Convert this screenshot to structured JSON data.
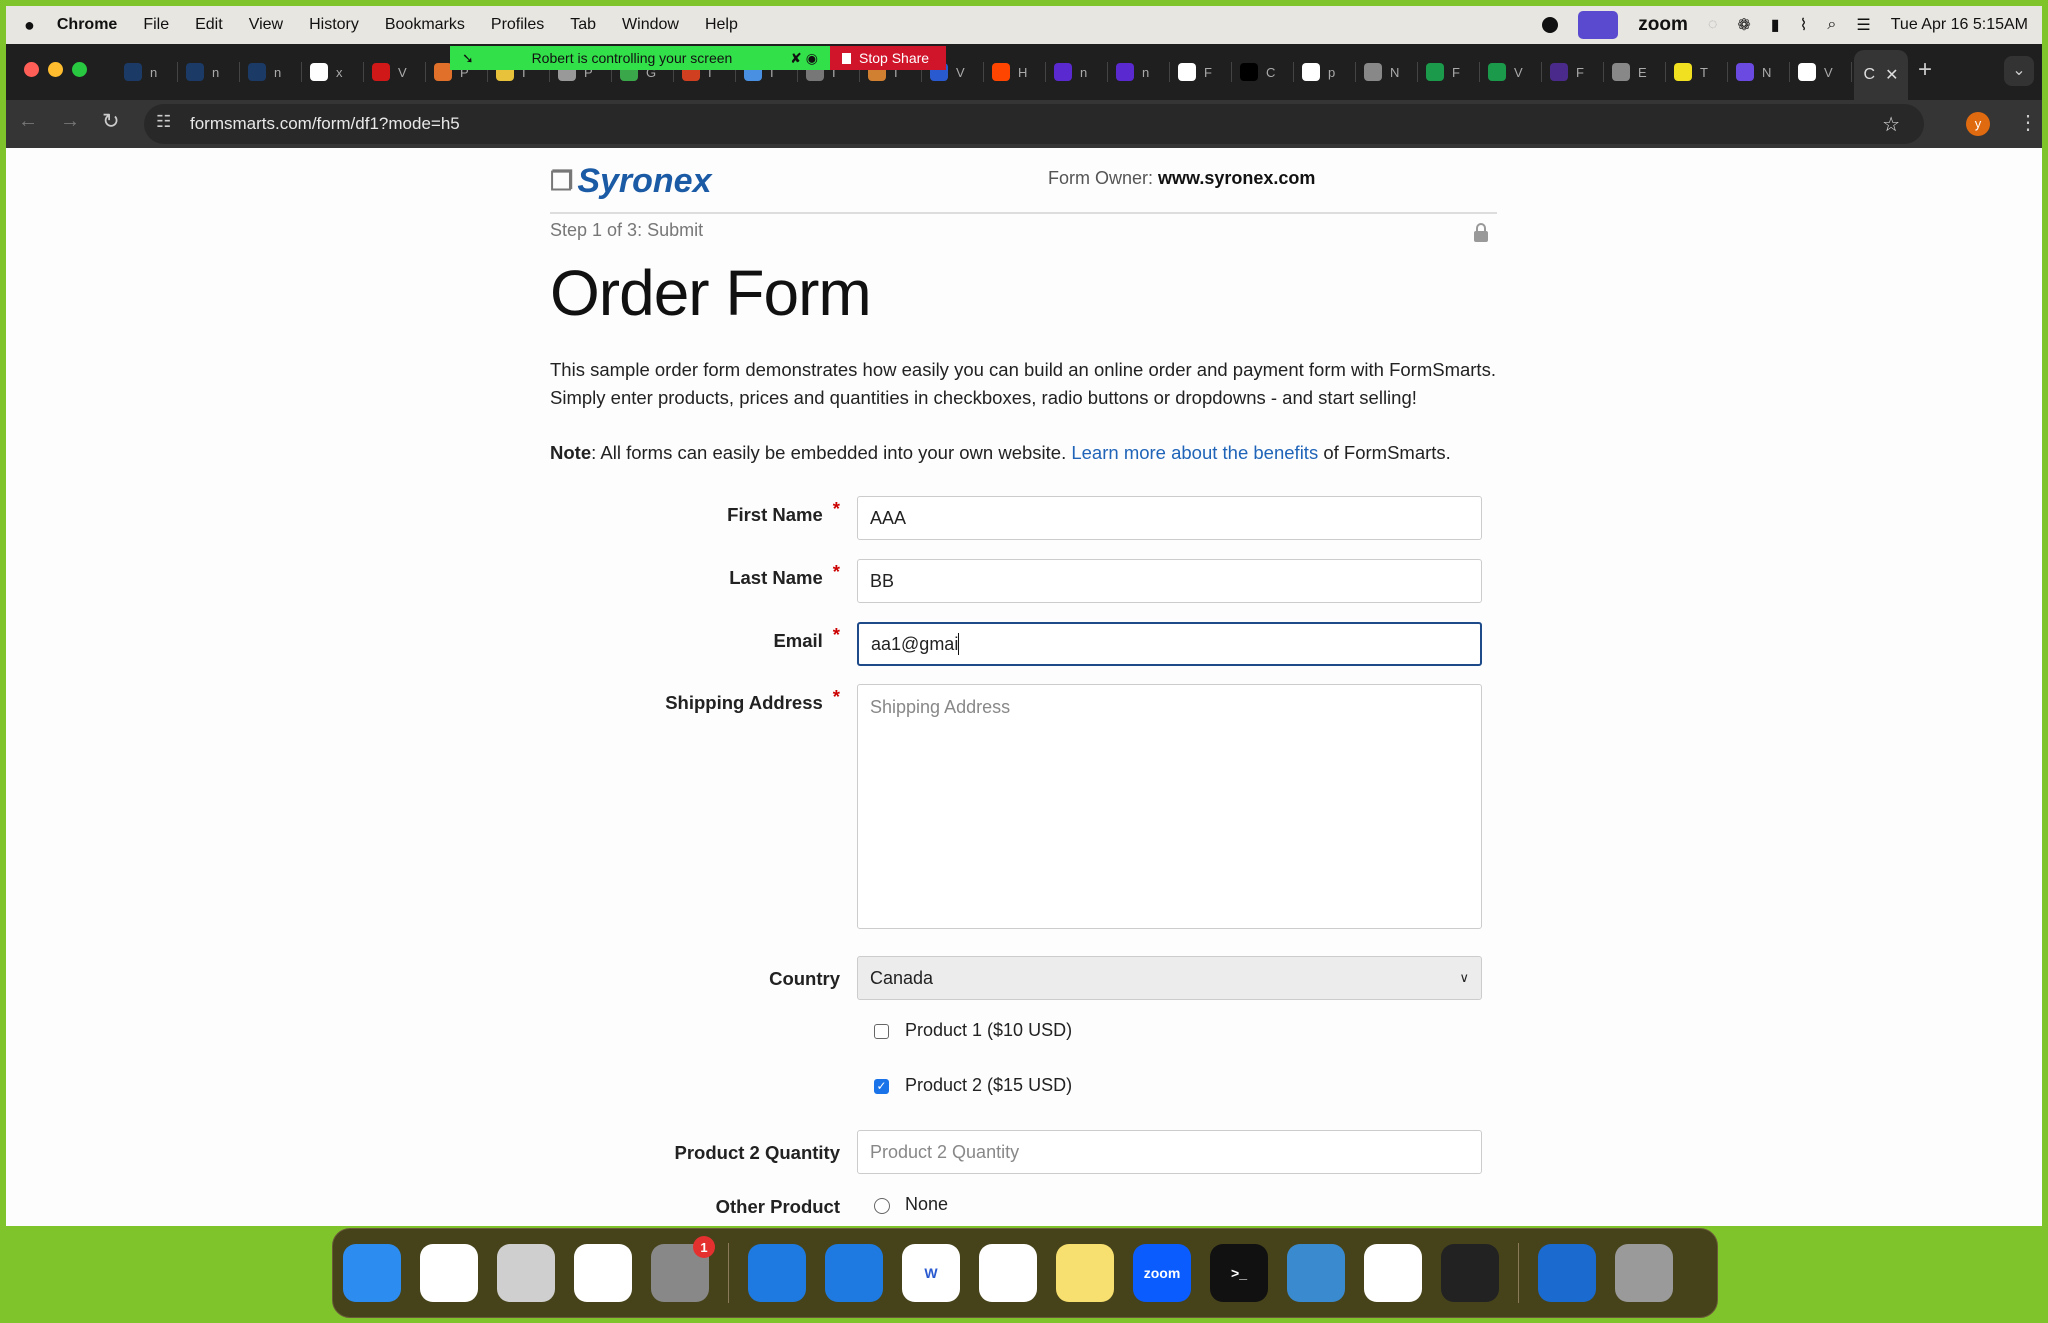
{
  "menubar": {
    "app": "Chrome",
    "items": [
      "File",
      "Edit",
      "View",
      "History",
      "Bookmarks",
      "Profiles",
      "Tab",
      "Window",
      "Help"
    ],
    "status": {
      "zoom_label": "zoom",
      "datetime": "Tue Apr 16  5:15AM"
    }
  },
  "zoom_share": {
    "message": "Robert is controlling your screen",
    "stop_label": "Stop Share",
    "color": "#32e14a",
    "stop_color": "#d0152b"
  },
  "tabs": [
    {
      "letter": "n",
      "color": "#1b3a66"
    },
    {
      "letter": "n",
      "color": "#1b3a66"
    },
    {
      "letter": "n",
      "color": "#1b3a66"
    },
    {
      "letter": "x",
      "color": "#ffffff"
    },
    {
      "letter": "V",
      "color": "#d01818"
    },
    {
      "letter": "P",
      "color": "#e0702a"
    },
    {
      "letter": "I",
      "color": "#e8c23a"
    },
    {
      "letter": "P",
      "color": "#999999"
    },
    {
      "letter": "G",
      "color": "#3aa84a"
    },
    {
      "letter": "I",
      "color": "#d04020"
    },
    {
      "letter": "I",
      "color": "#4a90e2"
    },
    {
      "letter": "I",
      "color": "#777777"
    },
    {
      "letter": "I",
      "color": "#d08030"
    },
    {
      "letter": "V",
      "color": "#2a5ad0"
    },
    {
      "letter": "H",
      "color": "#ff4500"
    },
    {
      "letter": "n",
      "color": "#5a2ad0"
    },
    {
      "letter": "n",
      "color": "#5a2ad0"
    },
    {
      "letter": "F",
      "color": "#ffffff"
    },
    {
      "letter": "C",
      "color": "#000000"
    },
    {
      "letter": "p",
      "color": "#ffffff"
    },
    {
      "letter": "N",
      "color": "#888888"
    },
    {
      "letter": "F",
      "color": "#1a9a4a"
    },
    {
      "letter": "V",
      "color": "#1a9a4a"
    },
    {
      "letter": "F",
      "color": "#4a2a8a"
    },
    {
      "letter": "E",
      "color": "#888888"
    },
    {
      "letter": "T",
      "color": "#f0e020"
    },
    {
      "letter": "N",
      "color": "#6a4ae0"
    },
    {
      "letter": "V",
      "color": "#ffffff"
    }
  ],
  "active_tab": {
    "letter": "C"
  },
  "address": {
    "url": "formsmarts.com/form/df1?mode=h5",
    "profile_initial": "y"
  },
  "form": {
    "logo": "Syronex",
    "owner_label": "Form Owner:",
    "owner_value": "www.syronex.com",
    "step": "Step 1 of 3: Submit",
    "title": "Order Form",
    "intro_line1": "This sample order form demonstrates how easily you can build an online order and payment form with FormSmarts.",
    "intro_line2": "Simply enter products, prices and quantities in checkboxes, radio buttons or dropdowns - and start selling!",
    "note_bold": "Note",
    "note_text": ": All forms can easily be embedded into your own website. ",
    "note_link": "Learn more about the benefits",
    "note_tail": " of FormSmarts.",
    "required_mark": "*",
    "first_name": {
      "label": "First Name",
      "value": "AAA"
    },
    "last_name": {
      "label": "Last Name",
      "value": "BB"
    },
    "email": {
      "label": "Email",
      "value": "aa1@gmai"
    },
    "shipping": {
      "label": "Shipping Address",
      "placeholder": "Shipping Address"
    },
    "country": {
      "label": "Country",
      "value": "Canada"
    },
    "product1": {
      "label": "Product 1 ($10 USD)",
      "checked": false
    },
    "product2": {
      "label": "Product 2 ($15 USD)",
      "checked": true
    },
    "product2_qty": {
      "label": "Product 2 Quantity",
      "placeholder": "Product 2 Quantity"
    },
    "other_product": {
      "label": "Other Product",
      "option": "None",
      "selected": false
    }
  },
  "dock": [
    {
      "name": "finder",
      "color": "#2d8cf0"
    },
    {
      "name": "vscode",
      "color": "#ffffff"
    },
    {
      "name": "launchpad",
      "color": "#cfcfcf"
    },
    {
      "name": "safari",
      "color": "#ffffff"
    },
    {
      "name": "system-settings",
      "color": "#888888",
      "badge": "1"
    },
    {
      "name": "app-store-tool",
      "color": "#1e7ae0"
    },
    {
      "name": "xcode",
      "color": "#1e7ae0"
    },
    {
      "name": "word",
      "color": "#ffffff",
      "text": "W"
    },
    {
      "name": "chrome",
      "color": "#ffffff"
    },
    {
      "name": "notes",
      "color": "#f8e070"
    },
    {
      "name": "zoom",
      "color": "#0b5cff",
      "text": "zoom"
    },
    {
      "name": "terminal",
      "color": "#111111",
      "text": ">_"
    },
    {
      "name": "screen",
      "color": "#3a8ad0"
    },
    {
      "name": "pinwheel",
      "color": "#ffffff"
    },
    {
      "name": "quicktime",
      "color": "#222222"
    },
    {
      "name": "downloads",
      "color": "#1a6ad0"
    },
    {
      "name": "trash",
      "color": "#9a9a9a"
    }
  ]
}
